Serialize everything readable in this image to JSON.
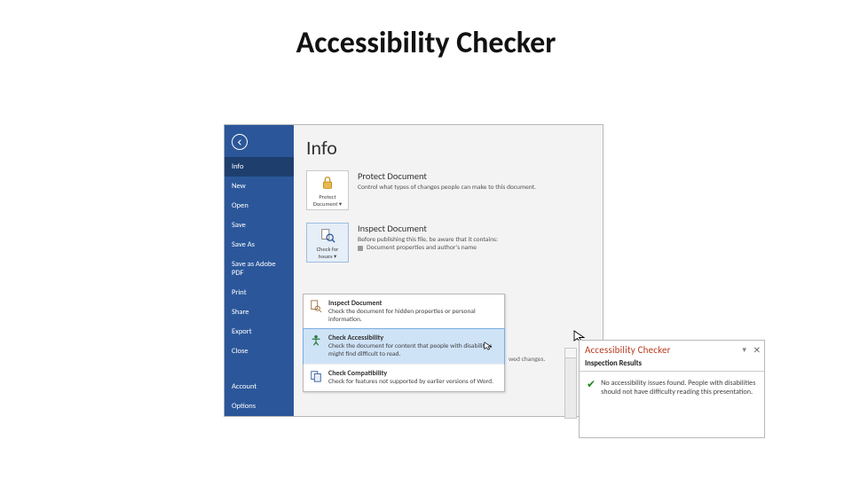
{
  "title": "Accessibility Checker",
  "sidebar": {
    "items": [
      "Info",
      "New",
      "Open",
      "Save",
      "Save As",
      "Save as Adobe PDF",
      "Print",
      "Share",
      "Export",
      "Close",
      "Account",
      "Options"
    ]
  },
  "selected_nav_index": 0,
  "pane": {
    "title": "Info",
    "protect": {
      "button_label": "Protect Document ▾",
      "heading": "Protect Document",
      "desc": "Control what types of changes people can make to this document."
    },
    "inspect": {
      "button_label": "Check for Issues ▾",
      "heading": "Inspect Document",
      "desc_intro": "Before publishing this file, be aware that it contains:",
      "desc_bullet": "Document properties and author's name"
    },
    "manage_note": "wed changes."
  },
  "dropdown": {
    "items": [
      {
        "title": "Inspect Document",
        "desc": "Check the document for hidden properties or personal information."
      },
      {
        "title": "Check Accessibility",
        "desc": "Check the document for content that people with disabilities might find difficult to read."
      },
      {
        "title": "Check Compatibility",
        "desc": "Check for features not supported by earlier versions of Word."
      }
    ],
    "highlight_index": 1
  },
  "ac_pane": {
    "title": "Accessibility Checker",
    "subheading": "Inspection Results",
    "body": "No accessibility issues found. People with disabilities should not have difficulty reading this presentation."
  }
}
